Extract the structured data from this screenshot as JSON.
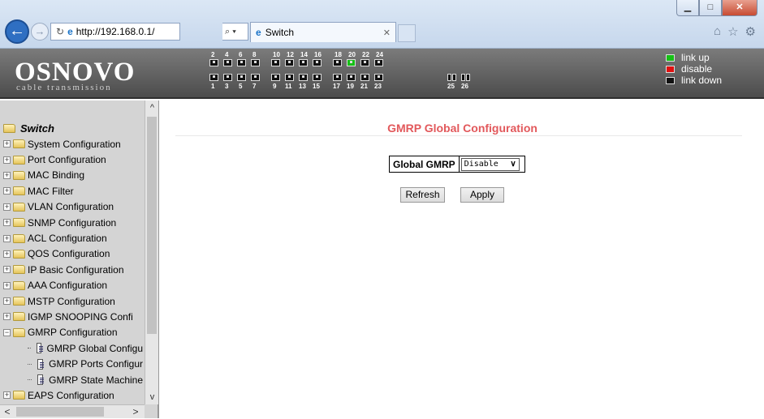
{
  "browser": {
    "address": "http://192.168.0.1/",
    "search_icon": "search-icon",
    "tab_title": "Switch",
    "window_buttons": [
      "minimize-icon",
      "maximize-icon",
      "close-icon"
    ]
  },
  "header": {
    "logo": "OSNOVO",
    "logo_sub": "cable transmission",
    "top_port_numbers": [
      "2",
      "4",
      "6",
      "8",
      "10",
      "12",
      "14",
      "16",
      "18",
      "20",
      "22",
      "24"
    ],
    "bottom_port_numbers": [
      "1",
      "3",
      "5",
      "7",
      "9",
      "11",
      "13",
      "15",
      "17",
      "19",
      "21",
      "23",
      "25",
      "26"
    ],
    "port_up": "20",
    "legend": {
      "link_up": "link up",
      "disable": "disable",
      "link_down": "link down",
      "colors": {
        "up": "#16c016",
        "disable": "#e01010",
        "down": "#111111"
      }
    }
  },
  "sidebar": {
    "root": "Switch",
    "items": [
      {
        "label": "System Configuration",
        "expander": "+"
      },
      {
        "label": "Port Configuration",
        "expander": "+"
      },
      {
        "label": "MAC Binding",
        "expander": "+"
      },
      {
        "label": "MAC Filter",
        "expander": "+"
      },
      {
        "label": "VLAN Configuration",
        "expander": "+"
      },
      {
        "label": "SNMP Configuration",
        "expander": "+"
      },
      {
        "label": "ACL Configuration",
        "expander": "+"
      },
      {
        "label": "QOS Configuration",
        "expander": "+"
      },
      {
        "label": "IP Basic Configuration",
        "expander": "+"
      },
      {
        "label": "AAA Configuration",
        "expander": "+"
      },
      {
        "label": "MSTP Configuration",
        "expander": "+"
      },
      {
        "label": "IGMP SNOOPING Confi",
        "expander": "+"
      },
      {
        "label": "GMRP Configuration",
        "expander": "−"
      }
    ],
    "subitems": [
      "GMRP Global Configu",
      "GMRP Ports Configur",
      "GMRP State Machine"
    ],
    "last_item": {
      "label": "EAPS Configuration",
      "expander": "+"
    }
  },
  "main": {
    "title": "GMRP Global Configuration",
    "global_gmrp_label": "Global GMRP",
    "global_gmrp_value": "Disable",
    "refresh_label": "Refresh",
    "apply_label": "Apply"
  }
}
